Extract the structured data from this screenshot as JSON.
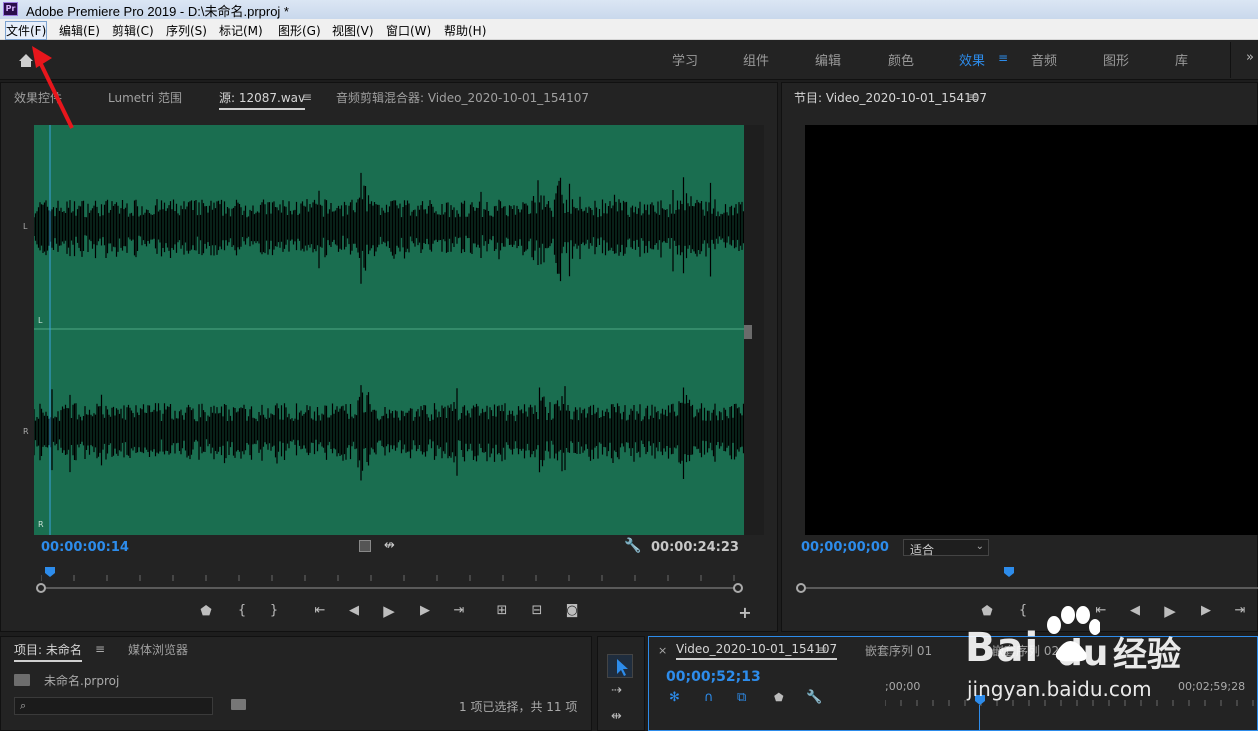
{
  "window": {
    "title": "Adobe Premiere Pro 2019 - D:\\未命名.prproj *",
    "icon_label": "Pr"
  },
  "menu": [
    "文件(F)",
    "编辑(E)",
    "剪辑(C)",
    "序列(S)",
    "标记(M)",
    "图形(G)",
    "视图(V)",
    "窗口(W)",
    "帮助(H)"
  ],
  "workspaces": [
    "学习",
    "组件",
    "编辑",
    "颜色",
    "效果",
    "音频",
    "图形",
    "库"
  ],
  "active_workspace": "效果",
  "source_panel": {
    "tabs": [
      "效果控件",
      "Lumetri 范围",
      "源: 12087.wav",
      "音频剪辑混合器: Video_2020-10-01_154107"
    ],
    "channel_labels": [
      "L",
      "L",
      "R",
      "R"
    ],
    "current_time": "00:00:00:14",
    "duration": "00:00:24:23"
  },
  "program_panel": {
    "title": "节目: Video_2020-10-01_154107",
    "current_time": "00;00;00;00",
    "fit": "适合"
  },
  "project_panel": {
    "tabs": [
      "项目: 未命名",
      "媒体浏览器"
    ],
    "project_file": "未命名.prproj",
    "selection_status": "1 项已选择，共 11 项"
  },
  "timeline_panel": {
    "tabs": [
      "Video_2020-10-01_154107",
      "嵌套序列 01",
      "嵌套序列 02"
    ],
    "current_time": "00;00;52;13",
    "ruler": [
      ";00;00",
      "00;02;59;28"
    ]
  },
  "watermark": {
    "brand_left": "Bai",
    "brand_right": "du",
    "brand_cn": "经验",
    "url": "jingyan.baidu.com"
  },
  "colors": {
    "accent": "#2d8ceb",
    "waveform_bg": "#1a6e50",
    "annotation_arrow": "#e8161c"
  }
}
